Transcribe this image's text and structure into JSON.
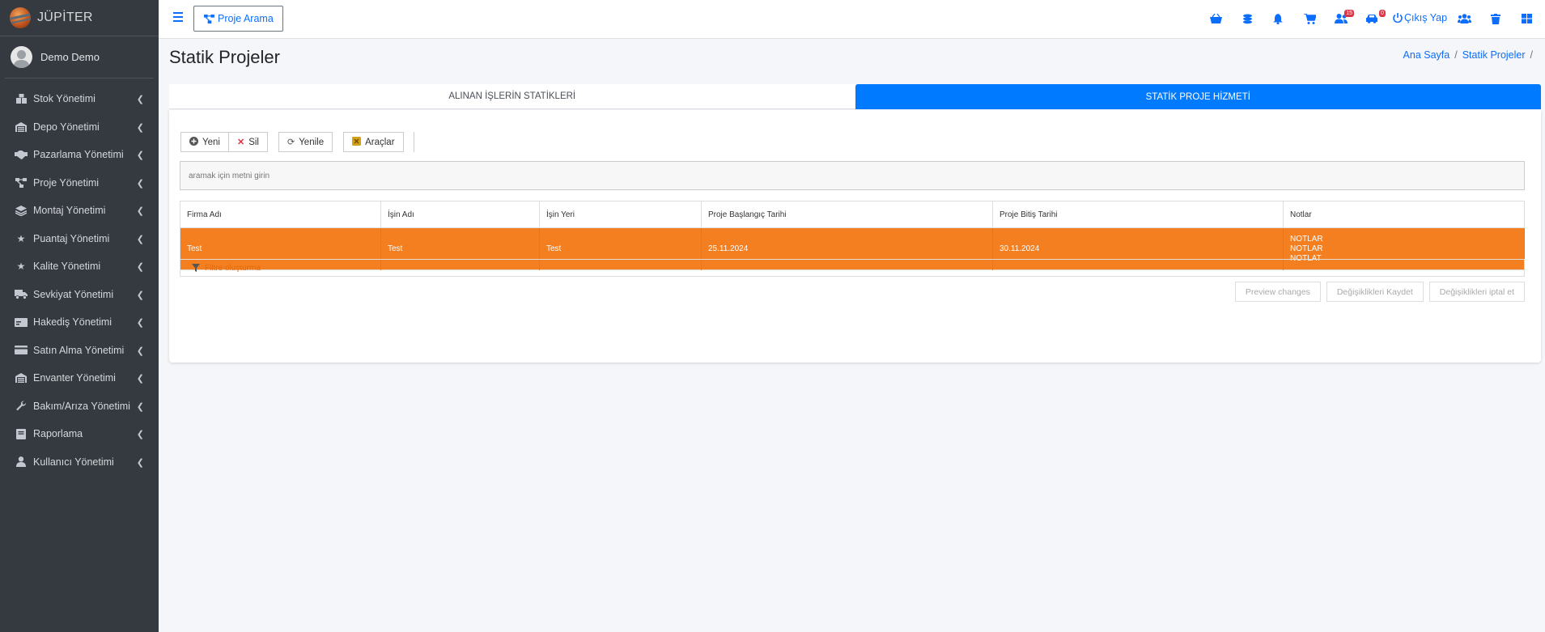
{
  "brand": {
    "name": "JÜPİTER"
  },
  "user": {
    "name": "Demo Demo"
  },
  "sidebar": {
    "items": [
      {
        "label": "Stok Yönetimi",
        "icon": "boxes-icon"
      },
      {
        "label": "Depo Yönetimi",
        "icon": "warehouse-icon"
      },
      {
        "label": "Pazarlama Yönetimi",
        "icon": "handshake-icon"
      },
      {
        "label": "Proje Yönetimi",
        "icon": "project-diagram-icon"
      },
      {
        "label": "Montaj Yönetimi",
        "icon": "layers-icon"
      },
      {
        "label": "Puantaj Yönetimi",
        "icon": "star-icon"
      },
      {
        "label": "Kalite Yönetimi",
        "icon": "star-icon"
      },
      {
        "label": "Sevkiyat Yönetimi",
        "icon": "truck-icon"
      },
      {
        "label": "Hakediş Yönetimi",
        "icon": "money-icon"
      },
      {
        "label": "Satın Alma Yönetimi",
        "icon": "credit-card-icon"
      },
      {
        "label": "Envanter Yönetimi",
        "icon": "warehouse-icon"
      },
      {
        "label": "Bakım/Arıza Yönetimi",
        "icon": "wrench-icon"
      },
      {
        "label": "Raporlama",
        "icon": "book-icon"
      },
      {
        "label": "Kullanıcı Yönetimi",
        "icon": "user-icon"
      }
    ]
  },
  "topbar": {
    "project_search_label": "Proje Arama",
    "badges": {
      "users": "15",
      "cars": "0"
    },
    "logout_label": "Çıkış Yap",
    "accent_color": "#0d6efd"
  },
  "page": {
    "title": "Statik Projeler",
    "breadcrumb": [
      "Ana Sayfa",
      "Statik Projeler"
    ]
  },
  "tabs": [
    {
      "label": "ALINAN İŞLERİN STATİKLERİ",
      "active": false
    },
    {
      "label": "STATİK PROJE HİZMETİ",
      "active": true
    }
  ],
  "toolbar": {
    "new_label": "Yeni",
    "delete_label": "Sil",
    "refresh_label": "Yenile",
    "tools_label": "Araçlar"
  },
  "search": {
    "placeholder": "aramak için metni girin"
  },
  "table": {
    "headers": [
      "Firma Adı",
      "İşin Adı",
      "İşin Yeri",
      "Proje Başlangıç Tarihi",
      "Proje Bitiş Tarihi",
      "Notlar"
    ],
    "rows": [
      {
        "firma": "Test",
        "is_adi": "Test",
        "is_yeri": "Test",
        "baslangic": "25.11.2024",
        "bitis": "30.11.2024",
        "notlar": [
          "NOTLAR",
          "NOTLAR",
          "NOTLAT"
        ]
      }
    ],
    "selected_row_color": "#f47f20"
  },
  "filter": {
    "label": "Filtre oluşturma"
  },
  "actions": {
    "preview_label": "Preview changes",
    "save_label": "Değişiklikleri Kaydet",
    "cancel_label": "Değişiklikleri iptal et"
  }
}
